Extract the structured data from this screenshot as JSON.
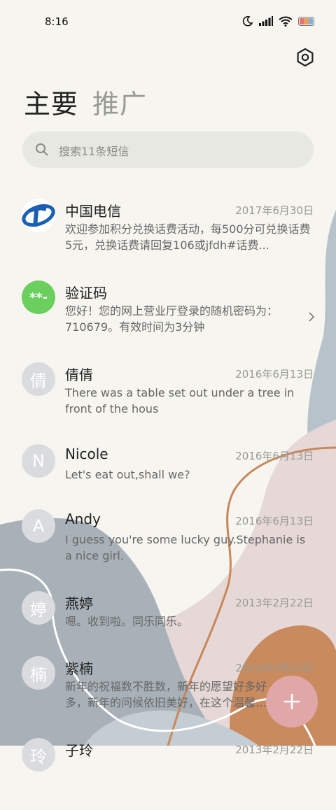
{
  "status_bar": {
    "time": "8:16"
  },
  "tabs": {
    "primary": "主要",
    "promotions": "推广"
  },
  "search": {
    "placeholder": "搜索11条短信"
  },
  "conversations": [
    {
      "name": "中国电信",
      "date": "2017年6月30日",
      "preview": "欢迎参加积分兑换话费活动，每500分可兑换话费5元，兑换话费请回复106或jfdh#话费...",
      "avatar": ""
    },
    {
      "name": "验证码",
      "date": "",
      "preview": "您好！您的网上营业厅登录的随机密码为：710679。有效时间为3分钟",
      "avatar": "**-"
    },
    {
      "name": "倩倩",
      "date": "2016年6月13日",
      "preview": "There was a table set out under a tree in front of the hous",
      "avatar": "倩"
    },
    {
      "name": "Nicole",
      "date": "2016年6月13日",
      "preview": "Let's eat out,shall we?",
      "avatar": "N"
    },
    {
      "name": "Andy",
      "date": "2016年6月13日",
      "preview": "I guess you're some lucky guy.Stephanie is a nice girl.",
      "avatar": "A"
    },
    {
      "name": "燕婷",
      "date": "2013年2月22日",
      "preview": "嗯。收到啦。同乐同乐。",
      "avatar": "婷"
    },
    {
      "name": "紫楠",
      "date": "2013年2月22日",
      "preview": "新年的祝福数不胜数，新年的愿望好多好多，新年的问候依旧美好，在这个温馨的时刻",
      "avatar": "楠"
    },
    {
      "name": "子玲",
      "date": "2013年2月22日",
      "preview": "",
      "avatar": "玲"
    }
  ],
  "fab": {
    "label": "+"
  }
}
